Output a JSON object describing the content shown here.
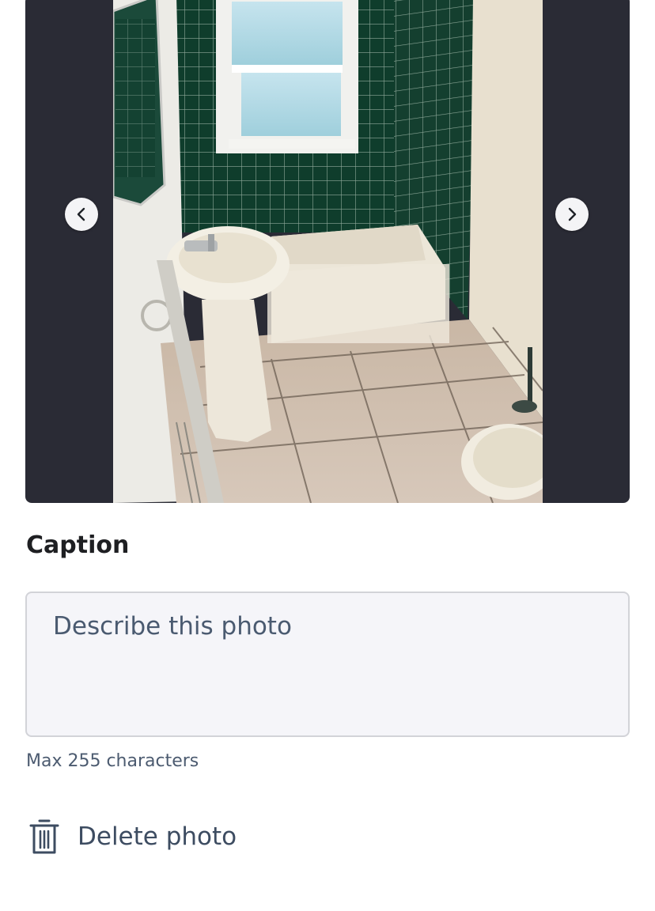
{
  "carousel": {
    "prev_icon": "chevron-left-icon",
    "next_icon": "chevron-right-icon",
    "photo_alt": "Bathroom photo"
  },
  "caption": {
    "label": "Caption",
    "placeholder": "Describe this photo",
    "value": "",
    "hint": "Max 255 characters"
  },
  "actions": {
    "delete_icon": "trash-icon",
    "delete_label": "Delete photo"
  },
  "colors": {
    "carousel_bg": "#2a2b35",
    "input_bg": "#f5f5f9",
    "text_muted": "#4c5b70"
  }
}
